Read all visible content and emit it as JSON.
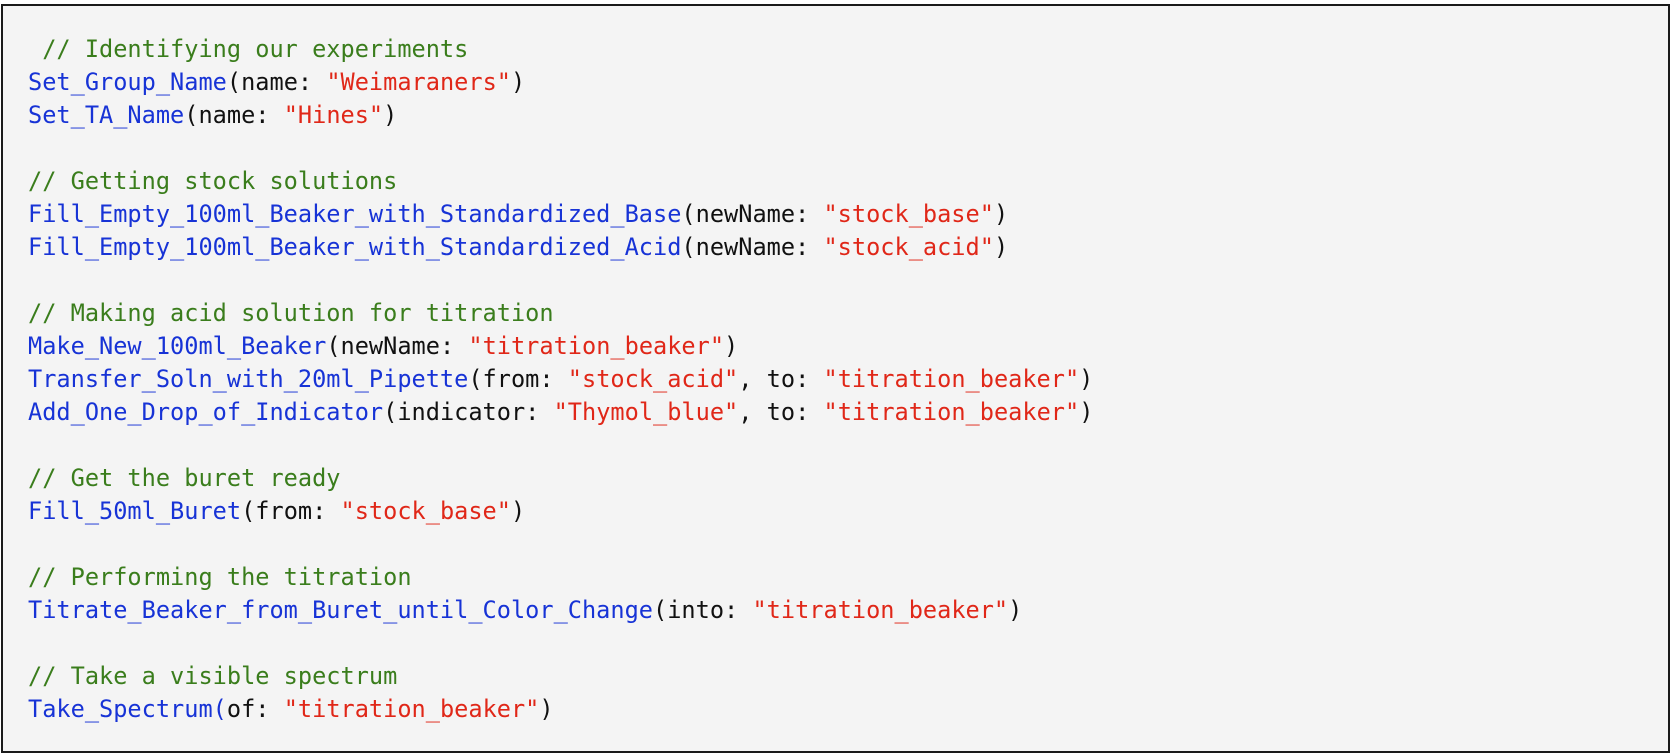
{
  "code": {
    "lines": [
      [
        {
          "t": "comment",
          "v": " // Identifying our experiments"
        }
      ],
      [
        {
          "t": "func",
          "v": "Set_Group_Name"
        },
        {
          "t": "plain",
          "v": "(name: "
        },
        {
          "t": "str",
          "v": "\"Weimaraners\""
        },
        {
          "t": "plain",
          "v": ")"
        }
      ],
      [
        {
          "t": "func",
          "v": "Set_TA_Name"
        },
        {
          "t": "plain",
          "v": "(name: "
        },
        {
          "t": "str",
          "v": "\"Hines\""
        },
        {
          "t": "plain",
          "v": ")"
        }
      ],
      [],
      [
        {
          "t": "comment",
          "v": "// Getting stock solutions"
        }
      ],
      [
        {
          "t": "func",
          "v": "Fill_Empty_100ml_Beaker_with_Standardized_Base"
        },
        {
          "t": "plain",
          "v": "(newName: "
        },
        {
          "t": "str",
          "v": "\"stock_base\""
        },
        {
          "t": "plain",
          "v": ")"
        }
      ],
      [
        {
          "t": "func",
          "v": "Fill_Empty_100ml_Beaker_with_Standardized_Acid"
        },
        {
          "t": "plain",
          "v": "(newName: "
        },
        {
          "t": "str",
          "v": "\"stock_acid\""
        },
        {
          "t": "plain",
          "v": ")"
        }
      ],
      [],
      [
        {
          "t": "comment",
          "v": "// Making acid solution for titration"
        }
      ],
      [
        {
          "t": "func",
          "v": "Make_New_100ml_Beaker"
        },
        {
          "t": "plain",
          "v": "(newName: "
        },
        {
          "t": "str",
          "v": "\"titration_beaker\""
        },
        {
          "t": "plain",
          "v": ")"
        }
      ],
      [
        {
          "t": "func",
          "v": "Transfer_Soln_with_20ml_Pipette"
        },
        {
          "t": "plain",
          "v": "(from: "
        },
        {
          "t": "str",
          "v": "\"stock_acid\""
        },
        {
          "t": "plain",
          "v": ", to: "
        },
        {
          "t": "str",
          "v": "\"titration_beaker\""
        },
        {
          "t": "plain",
          "v": ")"
        }
      ],
      [
        {
          "t": "func",
          "v": "Add_One_Drop_of_Indicator"
        },
        {
          "t": "plain",
          "v": "(indicator: "
        },
        {
          "t": "str",
          "v": "\"Thymol_blue\""
        },
        {
          "t": "plain",
          "v": ", to: "
        },
        {
          "t": "str",
          "v": "\"titration_beaker\""
        },
        {
          "t": "plain",
          "v": ")"
        }
      ],
      [],
      [
        {
          "t": "comment",
          "v": "// Get the buret ready"
        }
      ],
      [
        {
          "t": "func",
          "v": "Fill_50ml_Buret"
        },
        {
          "t": "plain",
          "v": "(from: "
        },
        {
          "t": "str",
          "v": "\"stock_base\""
        },
        {
          "t": "plain",
          "v": ")"
        }
      ],
      [],
      [
        {
          "t": "comment",
          "v": "// Performing the titration"
        }
      ],
      [
        {
          "t": "func",
          "v": "Titrate_Beaker_from_Buret_until_Color_Change"
        },
        {
          "t": "plain",
          "v": "(into: "
        },
        {
          "t": "str",
          "v": "\"titration_beaker\""
        },
        {
          "t": "plain",
          "v": ")"
        }
      ],
      [],
      [
        {
          "t": "comment",
          "v": "// Take a visible spectrum"
        }
      ],
      [
        {
          "t": "func",
          "v": "Take_Spectrum("
        },
        {
          "t": "plain",
          "v": "of: "
        },
        {
          "t": "str",
          "v": "\"titration_beaker\""
        },
        {
          "t": "plain",
          "v": ")"
        }
      ]
    ]
  },
  "colors": {
    "comment": "#3a7d1c",
    "func": "#1733d6",
    "str": "#e02718",
    "plain": "#111111",
    "background": "#f4f4f4",
    "border": "#1a1a1a"
  }
}
